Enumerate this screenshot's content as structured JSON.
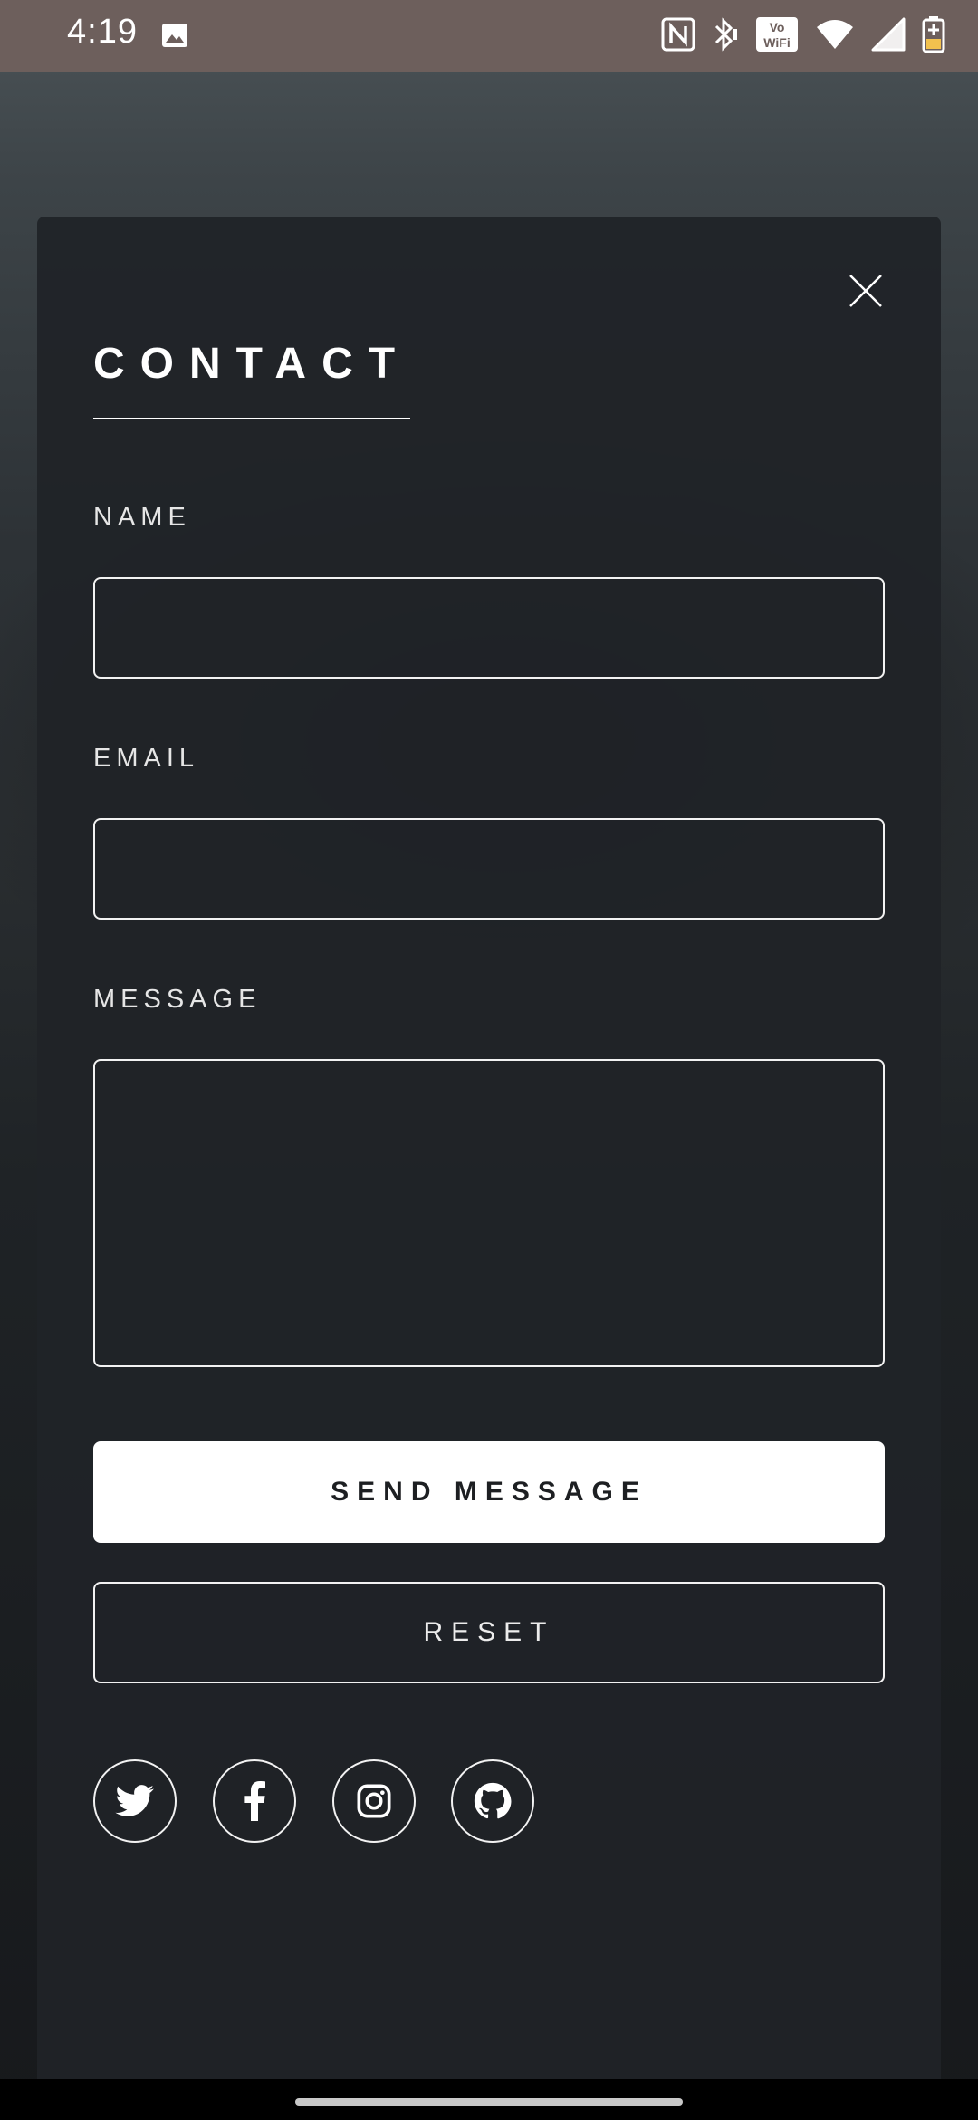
{
  "status_bar": {
    "time": "4:19",
    "icons": [
      "gallery-icon",
      "nfc-icon",
      "bluetooth-icon",
      "vowifi-icon",
      "wifi-icon",
      "signal-icon",
      "battery-icon"
    ],
    "vowifi_text_top": "Vo",
    "vowifi_text_bottom": "WiFi"
  },
  "modal": {
    "title": "CONTACT",
    "fields": {
      "name_label": "NAME",
      "name_value": "",
      "email_label": "EMAIL",
      "email_value": "",
      "message_label": "MESSAGE",
      "message_value": ""
    },
    "buttons": {
      "send_label": "SEND MESSAGE",
      "reset_label": "RESET"
    },
    "social": [
      "twitter-icon",
      "facebook-icon",
      "instagram-icon",
      "github-icon"
    ]
  },
  "colors": {
    "status_bar_bg": "#6d5f5c",
    "modal_bg": "#202327",
    "accent": "#ffffff"
  }
}
